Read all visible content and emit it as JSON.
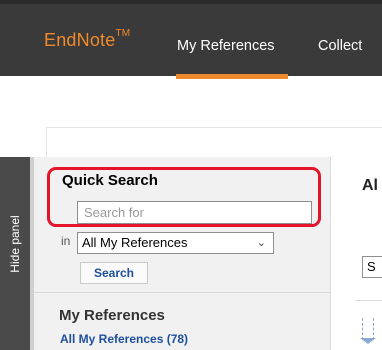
{
  "header": {
    "brand": "EndNote",
    "brand_tm": "TM",
    "nav": [
      {
        "label": "My References",
        "active": true
      },
      {
        "label": "Collect",
        "active": false
      }
    ]
  },
  "side_tab": {
    "label": "Hide panel"
  },
  "quick_search": {
    "title": "Quick Search",
    "placeholder": "Search for",
    "in_label": "in",
    "scope_value": "All My References",
    "search_button": "Search"
  },
  "my_references": {
    "title": "My References",
    "all_link": "All My References (78)"
  },
  "right_area": {
    "heading_fragment": "Al",
    "select_fragment": "S"
  },
  "colors": {
    "accent": "#ef8a2c",
    "nav_bg": "#3a3a3a",
    "highlight": "#e4142a",
    "link": "#1e4f9c"
  }
}
